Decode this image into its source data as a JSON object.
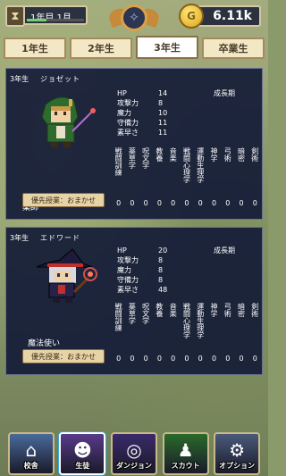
{
  "header": {
    "date": "1年目 1月",
    "date_progress": 0.35,
    "money": "6.11k",
    "coin_symbol": "G"
  },
  "tabs": [
    {
      "label": "1年生",
      "active": false
    },
    {
      "label": "2年生",
      "active": false
    },
    {
      "label": "3年生",
      "active": true
    },
    {
      "label": "卒業生",
      "active": false
    }
  ],
  "stat_labels": [
    "HP",
    "攻撃力",
    "魔力",
    "守備力",
    "素早さ"
  ],
  "growth_label": "成長期",
  "subject_labels": [
    "戦闘訓練",
    "薬草学",
    "呪文学",
    "教養",
    "音楽",
    "戦闘心理学",
    "運動生理学",
    "神学",
    "弓術",
    "暗密",
    "剣術"
  ],
  "priority_label": "優先授業：おまかせ",
  "students": [
    {
      "year": "3年生",
      "name": "ジョゼット",
      "job": "薬師",
      "stats": [
        "14",
        "8",
        "10",
        "11",
        "11"
      ],
      "subjects": [
        "0",
        "0",
        "0",
        "0",
        "0",
        "0",
        "0",
        "0",
        "0",
        "0",
        "0"
      ]
    },
    {
      "year": "3年生",
      "name": "エドワード",
      "job": "魔法使い",
      "stats": [
        "20",
        "8",
        "8",
        "8",
        "48"
      ],
      "subjects": [
        "0",
        "0",
        "0",
        "0",
        "0",
        "0",
        "0",
        "0",
        "0",
        "0",
        "0"
      ]
    }
  ],
  "nav": [
    {
      "label": "校舎",
      "icon": "school-icon",
      "color": "#4a6a9a"
    },
    {
      "label": "生徒",
      "icon": "student-icon",
      "color": "#5a3a8a",
      "active": true
    },
    {
      "label": "ダンジョン",
      "icon": "dungeon-icon",
      "color": "#3a2a6a"
    },
    {
      "label": "スカウト",
      "icon": "scout-icon",
      "color": "#2a6a2a"
    },
    {
      "label": "オプション",
      "icon": "options-icon",
      "color": "#4a5a7a"
    }
  ]
}
